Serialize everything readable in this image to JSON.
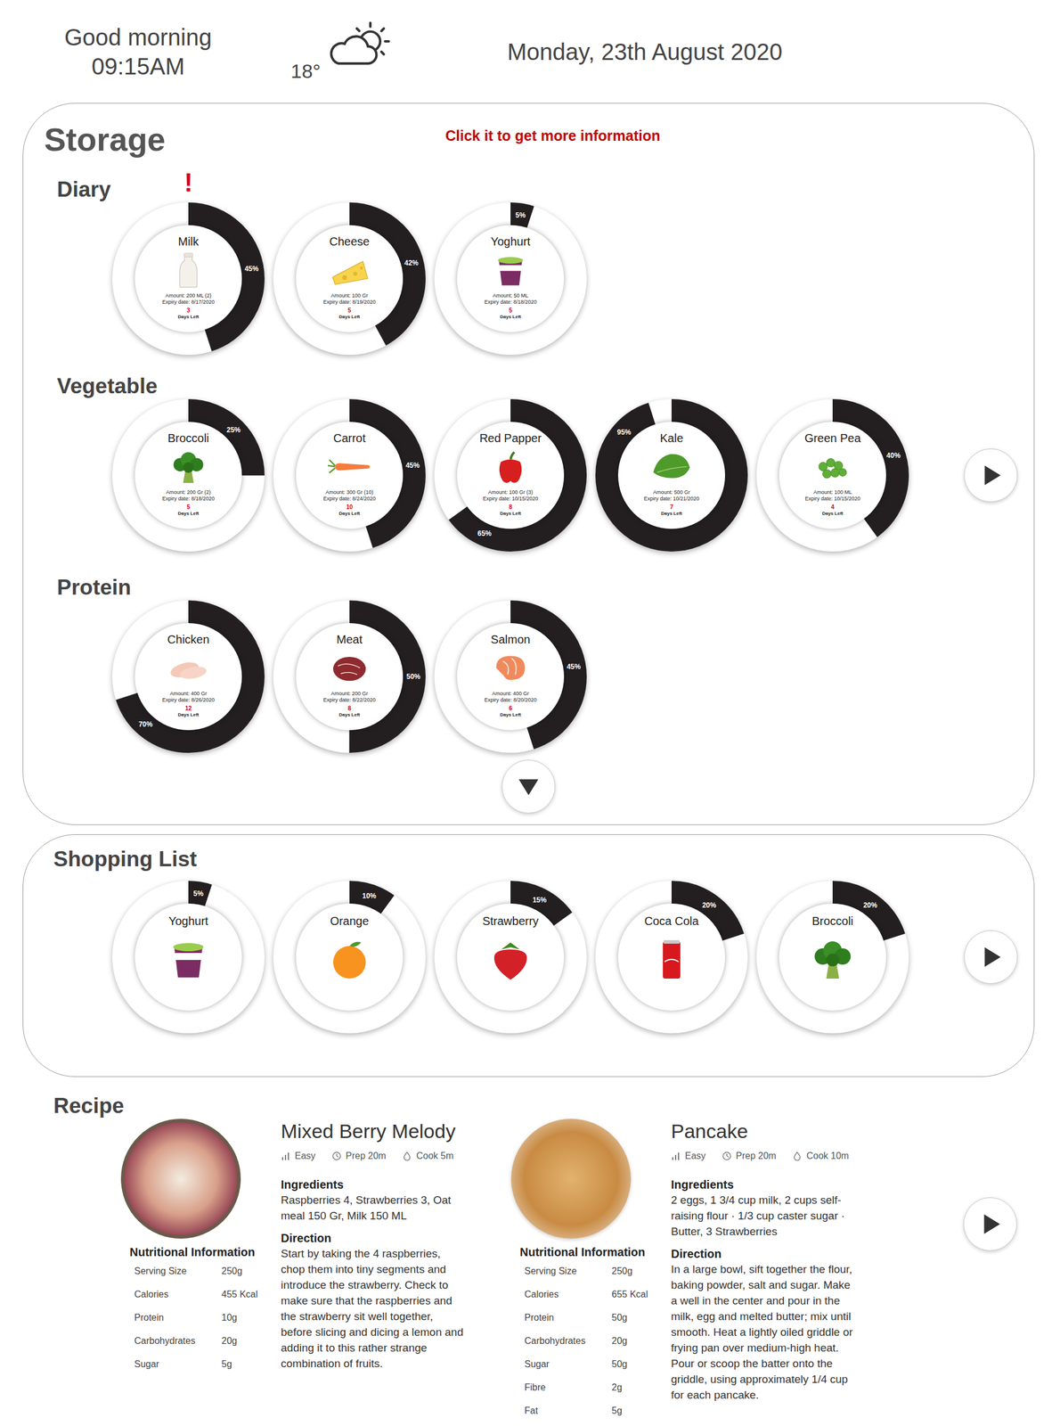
{
  "header": {
    "greeting": "Good morning",
    "time": "09:15AM",
    "temperature": "18°",
    "date": "Monday, 23th August 2020"
  },
  "storage": {
    "title": "Storage",
    "hint": "Click it to get more information",
    "alert_mark": "!",
    "expandable": true,
    "categories": [
      {
        "name": "Diary",
        "has_more": false,
        "items": [
          {
            "name": "Milk",
            "kind": "milk",
            "level": 0.45,
            "reading": "45%",
            "amount": "Amount: 200 ML (2)",
            "expiry": "Expiry date: 8/17/2020",
            "days": "3",
            "days_label": "Days Left",
            "alert": true
          },
          {
            "name": "Cheese",
            "kind": "cheese",
            "level": 0.42,
            "reading": "42%",
            "amount": "Amount: 100 Gr",
            "expiry": "Expiry date: 8/19/2020",
            "days": "5",
            "days_label": "Days Left",
            "alert": false
          },
          {
            "name": "Yoghurt",
            "kind": "yoghurt",
            "level": 0.05,
            "reading": "5%",
            "amount": "Amount: 50 ML",
            "expiry": "Expiry date: 8/18/2020",
            "days": "5",
            "days_label": "Days Left",
            "alert": false
          }
        ]
      },
      {
        "name": "Vegetable",
        "has_more": true,
        "items": [
          {
            "name": "Broccoli",
            "kind": "broccoli",
            "level": 0.25,
            "reading": "25%",
            "amount": "Amount: 200 Gr (2)",
            "expiry": "Expiry date: 8/18/2020",
            "days": "5",
            "days_label": "Days Left",
            "alert": false
          },
          {
            "name": "Carrot",
            "kind": "carrot",
            "level": 0.45,
            "reading": "45%",
            "amount": "Amount: 300 Gr (10)",
            "expiry": "Expiry date: 8/24/2020",
            "days": "10",
            "days_label": "Days Left",
            "alert": false
          },
          {
            "name": "Red Papper",
            "kind": "pepper",
            "level": 0.65,
            "reading": "65%",
            "amount": "Amount: 100 Gr (3)",
            "expiry": "Expiry date: 10/15/2020",
            "days": "8",
            "days_label": "Days Left",
            "alert": false
          },
          {
            "name": "Kale",
            "kind": "kale",
            "level": 0.95,
            "reading": "95%",
            "amount": "Amount: 500 Gr",
            "expiry": "Expiry date: 10/21/2020",
            "days": "7",
            "days_label": "Days Left",
            "alert": false
          },
          {
            "name": "Green Pea",
            "kind": "pea",
            "level": 0.4,
            "reading": "40%",
            "amount": "Amount: 100 ML",
            "expiry": "Expiry date: 10/15/2020",
            "days": "4",
            "days_label": "Days Left",
            "alert": false
          }
        ]
      },
      {
        "name": "Protein",
        "has_more": false,
        "items": [
          {
            "name": "Chicken",
            "kind": "chicken",
            "level": 0.7,
            "reading": "70%",
            "amount": "Amount: 400 Gr",
            "expiry": "Expiry date: 8/26/2020",
            "days": "12",
            "days_label": "Days Left",
            "alert": false
          },
          {
            "name": "Meat",
            "kind": "meat",
            "level": 0.5,
            "reading": "50%",
            "amount": "Amount: 200 Gr",
            "expiry": "Expiry date: 8/22/2020",
            "days": "8",
            "days_label": "Days Left",
            "alert": false
          },
          {
            "name": "Salmon",
            "kind": "salmon",
            "level": 0.45,
            "reading": "45%",
            "amount": "Amount: 400 Gr",
            "expiry": "Expiry date: 8/20/2020",
            "days": "6",
            "days_label": "Days Left",
            "alert": false
          }
        ]
      }
    ]
  },
  "shopping": {
    "title": "Shopping List",
    "has_more": true,
    "items": [
      {
        "name": "Yoghurt",
        "kind": "yoghurt",
        "level": 0.05,
        "reading": "5%"
      },
      {
        "name": "Orange",
        "kind": "orange",
        "level": 0.1,
        "reading": "10%"
      },
      {
        "name": "Strawberry",
        "kind": "strawberry",
        "level": 0.15,
        "reading": "15%"
      },
      {
        "name": "Coca Cola",
        "kind": "cola",
        "level": 0.2,
        "reading": "20%"
      },
      {
        "name": "Broccoli",
        "kind": "broccoli",
        "level": 0.2,
        "reading": "20%"
      }
    ]
  },
  "recipes": {
    "title": "Recipe",
    "has_more": true,
    "items": [
      {
        "title": "Mixed Berry Melody",
        "photo": "berries",
        "difficulty": "Easy",
        "prep": "Prep 20m",
        "cook": "Cook 5m",
        "ingredients_title": "Ingredients",
        "ingredients": "Raspberries 4, Strawberries 3, Oat meal 150 Gr, Milk 150 ML",
        "direction_title": "Direction",
        "direction": "Start by taking the 4 raspberries, chop them into tiny segments and introduce the strawberry. Check to make sure that the raspberries and the strawberry sit well together, before slicing and dicing a lemon and adding it to this rather strange combination of fruits.",
        "nutrition_title": "Nutritional Information",
        "nutrition": [
          {
            "label": "Serving Size",
            "value": "250g"
          },
          {
            "label": "Calories",
            "value": "455 Kcal"
          },
          {
            "label": "Protein",
            "value": "10g"
          },
          {
            "label": "Carbohydrates",
            "value": "20g"
          },
          {
            "label": "Sugar",
            "value": "5g"
          }
        ]
      },
      {
        "title": "Pancake",
        "photo": "pancake",
        "difficulty": "Easy",
        "prep": "Prep 20m",
        "cook": "Cook 10m",
        "ingredients_title": "Ingredients",
        "ingredients": "2 eggs, 1 3/4 cup milk, 2 cups self-raising flour · 1/3 cup caster sugar · Butter, 3 Strawberries",
        "direction_title": "Direction",
        "direction": "In a large bowl, sift together the flour, baking powder, salt and sugar. Make a well in the center and pour in the milk, egg and melted butter; mix until smooth. Heat a lightly oiled griddle or frying pan over medium-high heat. Pour or scoop the batter onto the griddle, using approximately 1/4 cup for each pancake.",
        "nutrition_title": "Nutritional Information",
        "nutrition": [
          {
            "label": "Serving Size",
            "value": "250g"
          },
          {
            "label": "Calories",
            "value": "655 Kcal"
          },
          {
            "label": "Protein",
            "value": "50g"
          },
          {
            "label": "Carbohydrates",
            "value": "20g"
          },
          {
            "label": "Sugar",
            "value": "50g"
          },
          {
            "label": "Fibre",
            "value": "2g"
          },
          {
            "label": "Fat",
            "value": "5g"
          }
        ]
      }
    ]
  }
}
